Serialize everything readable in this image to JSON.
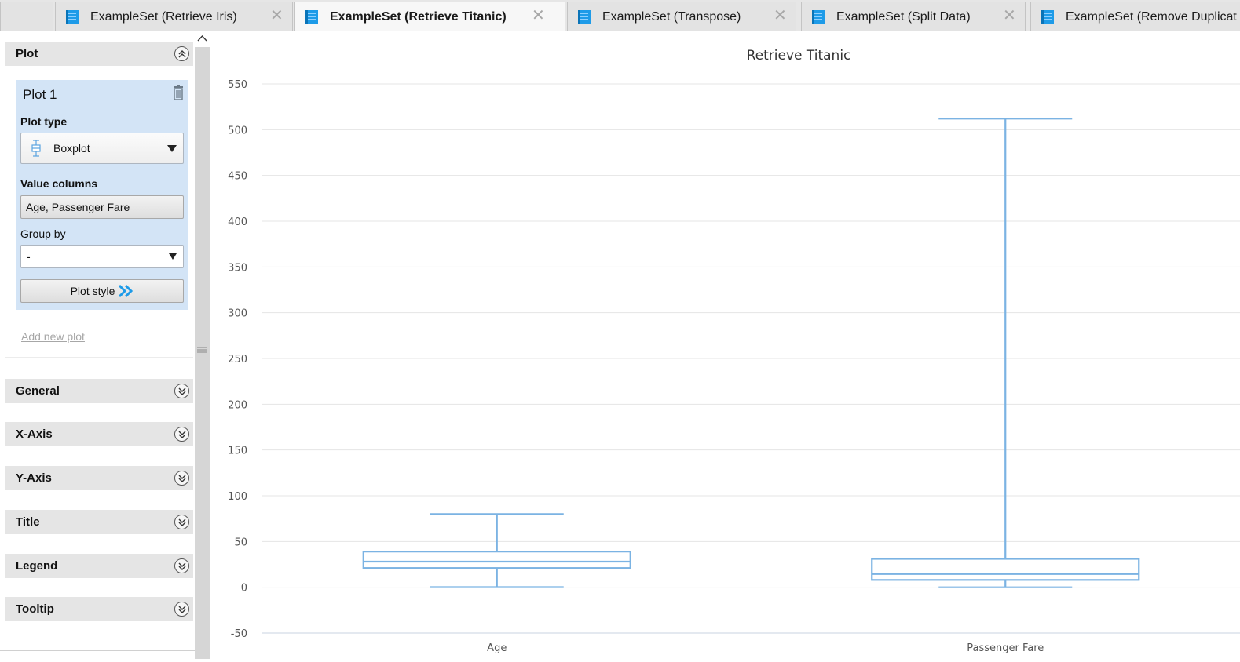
{
  "tabs": [
    {
      "label": "",
      "active": false,
      "icon": "none"
    },
    {
      "label": "ExampleSet (Retrieve Iris)",
      "active": false,
      "icon": "table-icon"
    },
    {
      "label": "ExampleSet (Retrieve Titanic)",
      "active": true,
      "icon": "table-icon"
    },
    {
      "label": "ExampleSet (Transpose)",
      "active": false,
      "icon": "table-icon"
    },
    {
      "label": "ExampleSet (Split Data)",
      "active": false,
      "icon": "table-icon"
    },
    {
      "label": "ExampleSet (Remove Duplicat",
      "active": false,
      "icon": "table-icon"
    }
  ],
  "close_glyph": "✕",
  "sidebar": {
    "plot_section": {
      "title": "Plot"
    },
    "plot_card": {
      "name": "Plot 1",
      "plot_type_label": "Plot type",
      "plot_type_value": "Boxplot",
      "value_columns_label": "Value columns",
      "value_columns_value": "Age, Passenger Fare",
      "group_by_label": "Group by",
      "group_by_value": "-",
      "plot_style_label": "Plot style"
    },
    "add_new_plot": "Add new plot",
    "sections": [
      "General",
      "X-Axis",
      "Y-Axis",
      "Title",
      "Legend",
      "Tooltip"
    ]
  },
  "colors": {
    "accent": "#1e9be8",
    "box_stroke": "#7bb3e3",
    "grid": "#e4e4e4",
    "plot_card_bg": "#d3e4f6"
  },
  "chart_data": {
    "type": "boxplot",
    "title": "Retrieve Titanic",
    "categories": [
      "Age",
      "Passenger Fare"
    ],
    "yticks": [
      -50,
      0,
      50,
      100,
      150,
      200,
      250,
      300,
      350,
      400,
      450,
      500,
      550
    ],
    "ylim": [
      -50,
      550
    ],
    "grid": true,
    "boxes": [
      {
        "name": "Age",
        "min": 0.17,
        "q1": 21,
        "median": 28,
        "q3": 39,
        "max": 80
      },
      {
        "name": "Passenger Fare",
        "min": 0,
        "q1": 8,
        "median": 14.5,
        "q3": 31,
        "max": 512
      }
    ]
  }
}
